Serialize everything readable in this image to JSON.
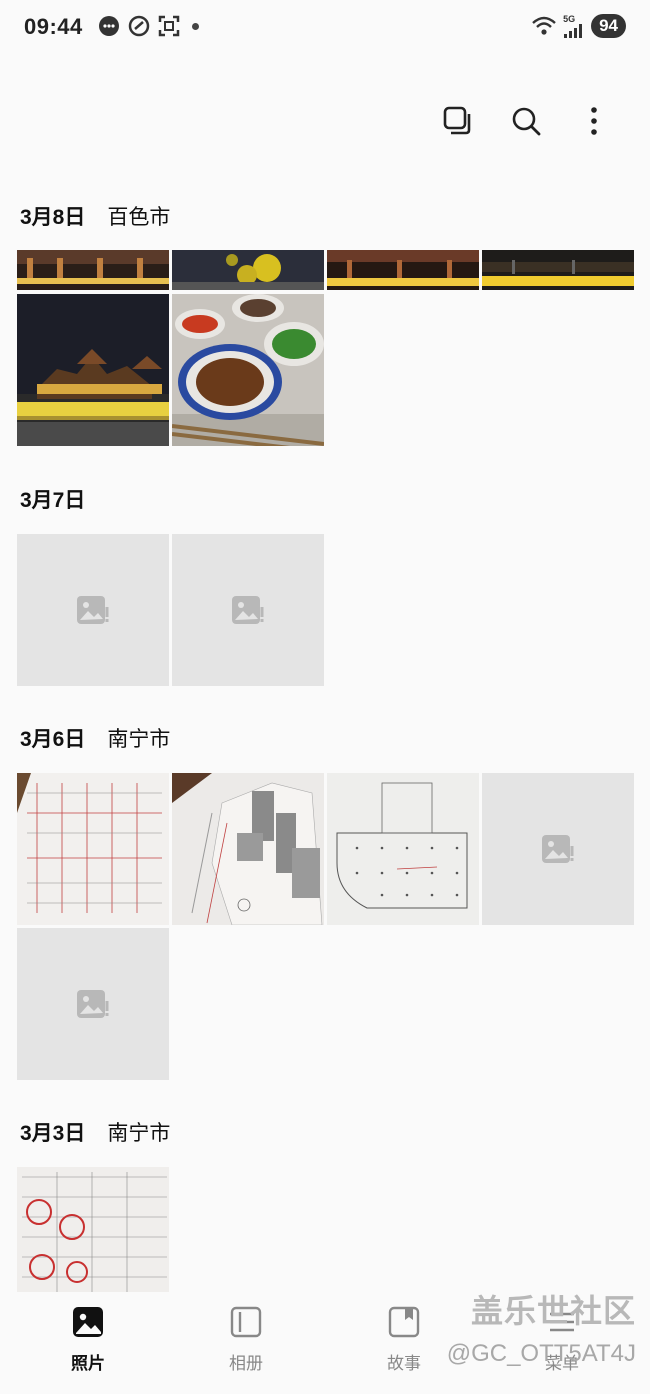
{
  "status_bar": {
    "time": "09:44",
    "network": "5G",
    "battery": "94"
  },
  "toolbar": {
    "select_icon": "select-icon",
    "search_icon": "search-icon",
    "more_icon": "more-vertical-icon"
  },
  "sections": [
    {
      "date": "3月8日",
      "location": "百色市"
    },
    {
      "date": "3月7日",
      "location": ""
    },
    {
      "date": "3月6日",
      "location": "南宁市"
    },
    {
      "date": "3月3日",
      "location": "南宁市"
    }
  ],
  "bottom_nav": {
    "items": [
      {
        "label": "照片",
        "icon": "photo-icon",
        "active": true
      },
      {
        "label": "相册",
        "icon": "album-icon",
        "active": false
      },
      {
        "label": "故事",
        "icon": "story-icon",
        "active": false
      },
      {
        "label": "菜单",
        "icon": "menu-icon",
        "active": false
      }
    ]
  },
  "watermark": {
    "line1": "盖乐世社区",
    "line2": "@GC_OTT5AT4J"
  }
}
